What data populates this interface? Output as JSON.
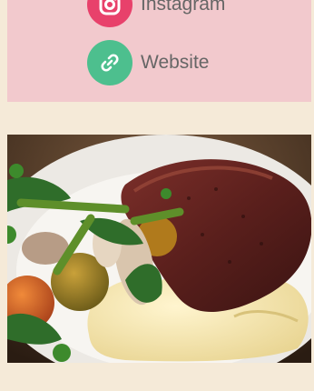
{
  "links": {
    "instagram": {
      "label": "Instagram",
      "icon": "instagram-icon",
      "color": "#e8416b"
    },
    "website": {
      "label": "Website",
      "icon": "link-icon",
      "color": "#4dbf8e"
    }
  },
  "colors": {
    "page_background": "#f5ead8",
    "links_card_background": "#f2c9cd",
    "label_text": "#666666"
  },
  "photo": {
    "subject": "steak-with-mashed-potatoes-and-vegetables"
  }
}
